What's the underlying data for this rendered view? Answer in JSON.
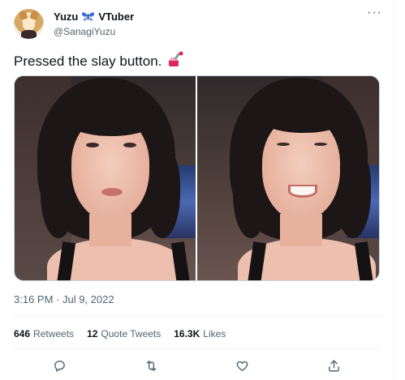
{
  "author": {
    "name": "Yuzu",
    "name_suffix": "VTuber",
    "handle": "@SanagiYuzu",
    "name_emoji": "butterfly-icon"
  },
  "tweet": {
    "text": "Pressed the slay button.",
    "emoji": "nail-polish-icon"
  },
  "media": {
    "photos": [
      {
        "alt": ""
      },
      {
        "alt": ""
      }
    ]
  },
  "timestamp": "3:16 PM · Jul 9, 2022",
  "stats": {
    "retweets_count": "646",
    "retweets_label": "Retweets",
    "quotes_count": "12",
    "quotes_label": "Quote Tweets",
    "likes_count": "16.3K",
    "likes_label": "Likes"
  },
  "actions": [
    "reply-icon",
    "retweet-icon",
    "like-icon",
    "share-icon"
  ],
  "colors": {
    "text": "#0f1419",
    "muted": "#536471",
    "border": "#eff3f4",
    "butterfly": "#3b6fd6",
    "nail_polish": "#e0245e"
  }
}
